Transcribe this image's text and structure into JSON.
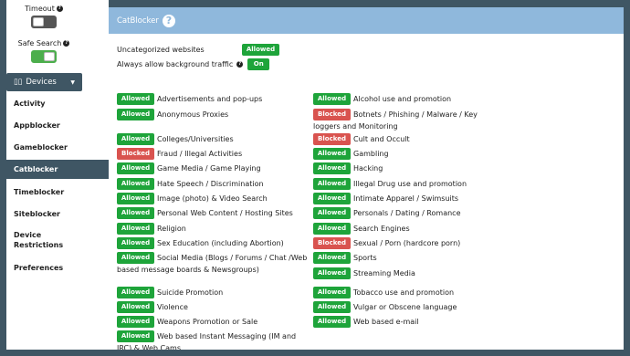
{
  "sidebar": {
    "timeout_label": "Timeout",
    "safe_search_label": "Safe Search",
    "devices_label": "Devices",
    "nav": [
      "Activity",
      "Appblocker",
      "Gameblocker",
      "Catblocker",
      "Timeblocker",
      "Siteblocker",
      "Device Restrictions",
      "Preferences"
    ],
    "active": "Catblocker"
  },
  "header": {
    "title": "CatBlocker"
  },
  "settings": {
    "uncategorized_label": "Uncategorized websites",
    "uncategorized_value": "Allowed",
    "background_label": "Always allow background traffic",
    "background_value": "On"
  },
  "categories_left": [
    {
      "status": "Allowed",
      "name": "Advertisements and pop-ups"
    },
    {
      "status": "Allowed",
      "name": "Anonymous Proxies"
    },
    {
      "status": "Allowed",
      "name": "Colleges/Universities"
    },
    {
      "status": "Blocked",
      "name": "Fraud / Illegal Activities"
    },
    {
      "status": "Allowed",
      "name": "Game Media / Game Playing"
    },
    {
      "status": "Allowed",
      "name": "Hate Speech / Discrimination"
    },
    {
      "status": "Allowed",
      "name": "Image (photo) & Video Search"
    },
    {
      "status": "Allowed",
      "name": "Personal Web Content / Hosting Sites"
    },
    {
      "status": "Allowed",
      "name": "Religion"
    },
    {
      "status": "Allowed",
      "name": "Sex Education (including Abortion)"
    },
    {
      "status": "Allowed",
      "name": "Social Media (Blogs / Forums / Chat /Web based message boards & Newsgroups)"
    },
    {
      "status": "Allowed",
      "name": "Suicide Promotion"
    },
    {
      "status": "Allowed",
      "name": "Violence"
    },
    {
      "status": "Allowed",
      "name": "Weapons Promotion or Sale"
    },
    {
      "status": "Allowed",
      "name": "Web based Instant Messaging (IM and IRC) & Web Cams"
    }
  ],
  "categories_right": [
    {
      "status": "Allowed",
      "name": "Alcohol use and promotion"
    },
    {
      "status": "Blocked",
      "name": "Botnets / Phishing / Malware / Key loggers and Monitoring"
    },
    {
      "status": "Blocked",
      "name": "Cult and Occult"
    },
    {
      "status": "Allowed",
      "name": "Gambling"
    },
    {
      "status": "Allowed",
      "name": "Hacking"
    },
    {
      "status": "Allowed",
      "name": "Illegal Drug use and promotion"
    },
    {
      "status": "Allowed",
      "name": "Intimate Apparel / Swimsuits"
    },
    {
      "status": "Allowed",
      "name": "Personals / Dating / Romance"
    },
    {
      "status": "Allowed",
      "name": "Search Engines"
    },
    {
      "status": "Blocked",
      "name": "Sexual / Porn (hardcore porn)"
    },
    {
      "status": "Allowed",
      "name": "Sports"
    },
    {
      "status": "Allowed",
      "name": "Streaming Media"
    },
    {
      "status": "Allowed",
      "name": "Tobacco use and promotion"
    },
    {
      "status": "Allowed",
      "name": "Vulgar or Obscene language"
    },
    {
      "status": "Allowed",
      "name": "Web based e-mail"
    }
  ]
}
